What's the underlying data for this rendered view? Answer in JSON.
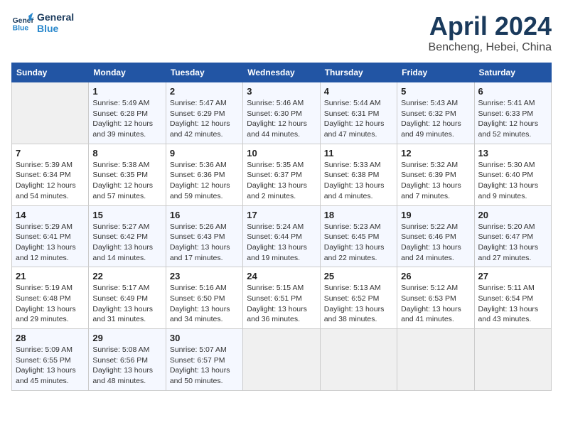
{
  "header": {
    "logo_line1": "General",
    "logo_line2": "Blue",
    "month_title": "April 2024",
    "subtitle": "Bencheng, Hebei, China"
  },
  "weekdays": [
    "Sunday",
    "Monday",
    "Tuesday",
    "Wednesday",
    "Thursday",
    "Friday",
    "Saturday"
  ],
  "weeks": [
    [
      {
        "day": "",
        "info": ""
      },
      {
        "day": "1",
        "info": "Sunrise: 5:49 AM\nSunset: 6:28 PM\nDaylight: 12 hours\nand 39 minutes."
      },
      {
        "day": "2",
        "info": "Sunrise: 5:47 AM\nSunset: 6:29 PM\nDaylight: 12 hours\nand 42 minutes."
      },
      {
        "day": "3",
        "info": "Sunrise: 5:46 AM\nSunset: 6:30 PM\nDaylight: 12 hours\nand 44 minutes."
      },
      {
        "day": "4",
        "info": "Sunrise: 5:44 AM\nSunset: 6:31 PM\nDaylight: 12 hours\nand 47 minutes."
      },
      {
        "day": "5",
        "info": "Sunrise: 5:43 AM\nSunset: 6:32 PM\nDaylight: 12 hours\nand 49 minutes."
      },
      {
        "day": "6",
        "info": "Sunrise: 5:41 AM\nSunset: 6:33 PM\nDaylight: 12 hours\nand 52 minutes."
      }
    ],
    [
      {
        "day": "7",
        "info": "Sunrise: 5:39 AM\nSunset: 6:34 PM\nDaylight: 12 hours\nand 54 minutes."
      },
      {
        "day": "8",
        "info": "Sunrise: 5:38 AM\nSunset: 6:35 PM\nDaylight: 12 hours\nand 57 minutes."
      },
      {
        "day": "9",
        "info": "Sunrise: 5:36 AM\nSunset: 6:36 PM\nDaylight: 12 hours\nand 59 minutes."
      },
      {
        "day": "10",
        "info": "Sunrise: 5:35 AM\nSunset: 6:37 PM\nDaylight: 13 hours\nand 2 minutes."
      },
      {
        "day": "11",
        "info": "Sunrise: 5:33 AM\nSunset: 6:38 PM\nDaylight: 13 hours\nand 4 minutes."
      },
      {
        "day": "12",
        "info": "Sunrise: 5:32 AM\nSunset: 6:39 PM\nDaylight: 13 hours\nand 7 minutes."
      },
      {
        "day": "13",
        "info": "Sunrise: 5:30 AM\nSunset: 6:40 PM\nDaylight: 13 hours\nand 9 minutes."
      }
    ],
    [
      {
        "day": "14",
        "info": "Sunrise: 5:29 AM\nSunset: 6:41 PM\nDaylight: 13 hours\nand 12 minutes."
      },
      {
        "day": "15",
        "info": "Sunrise: 5:27 AM\nSunset: 6:42 PM\nDaylight: 13 hours\nand 14 minutes."
      },
      {
        "day": "16",
        "info": "Sunrise: 5:26 AM\nSunset: 6:43 PM\nDaylight: 13 hours\nand 17 minutes."
      },
      {
        "day": "17",
        "info": "Sunrise: 5:24 AM\nSunset: 6:44 PM\nDaylight: 13 hours\nand 19 minutes."
      },
      {
        "day": "18",
        "info": "Sunrise: 5:23 AM\nSunset: 6:45 PM\nDaylight: 13 hours\nand 22 minutes."
      },
      {
        "day": "19",
        "info": "Sunrise: 5:22 AM\nSunset: 6:46 PM\nDaylight: 13 hours\nand 24 minutes."
      },
      {
        "day": "20",
        "info": "Sunrise: 5:20 AM\nSunset: 6:47 PM\nDaylight: 13 hours\nand 27 minutes."
      }
    ],
    [
      {
        "day": "21",
        "info": "Sunrise: 5:19 AM\nSunset: 6:48 PM\nDaylight: 13 hours\nand 29 minutes."
      },
      {
        "day": "22",
        "info": "Sunrise: 5:17 AM\nSunset: 6:49 PM\nDaylight: 13 hours\nand 31 minutes."
      },
      {
        "day": "23",
        "info": "Sunrise: 5:16 AM\nSunset: 6:50 PM\nDaylight: 13 hours\nand 34 minutes."
      },
      {
        "day": "24",
        "info": "Sunrise: 5:15 AM\nSunset: 6:51 PM\nDaylight: 13 hours\nand 36 minutes."
      },
      {
        "day": "25",
        "info": "Sunrise: 5:13 AM\nSunset: 6:52 PM\nDaylight: 13 hours\nand 38 minutes."
      },
      {
        "day": "26",
        "info": "Sunrise: 5:12 AM\nSunset: 6:53 PM\nDaylight: 13 hours\nand 41 minutes."
      },
      {
        "day": "27",
        "info": "Sunrise: 5:11 AM\nSunset: 6:54 PM\nDaylight: 13 hours\nand 43 minutes."
      }
    ],
    [
      {
        "day": "28",
        "info": "Sunrise: 5:09 AM\nSunset: 6:55 PM\nDaylight: 13 hours\nand 45 minutes."
      },
      {
        "day": "29",
        "info": "Sunrise: 5:08 AM\nSunset: 6:56 PM\nDaylight: 13 hours\nand 48 minutes."
      },
      {
        "day": "30",
        "info": "Sunrise: 5:07 AM\nSunset: 6:57 PM\nDaylight: 13 hours\nand 50 minutes."
      },
      {
        "day": "",
        "info": ""
      },
      {
        "day": "",
        "info": ""
      },
      {
        "day": "",
        "info": ""
      },
      {
        "day": "",
        "info": ""
      }
    ]
  ]
}
